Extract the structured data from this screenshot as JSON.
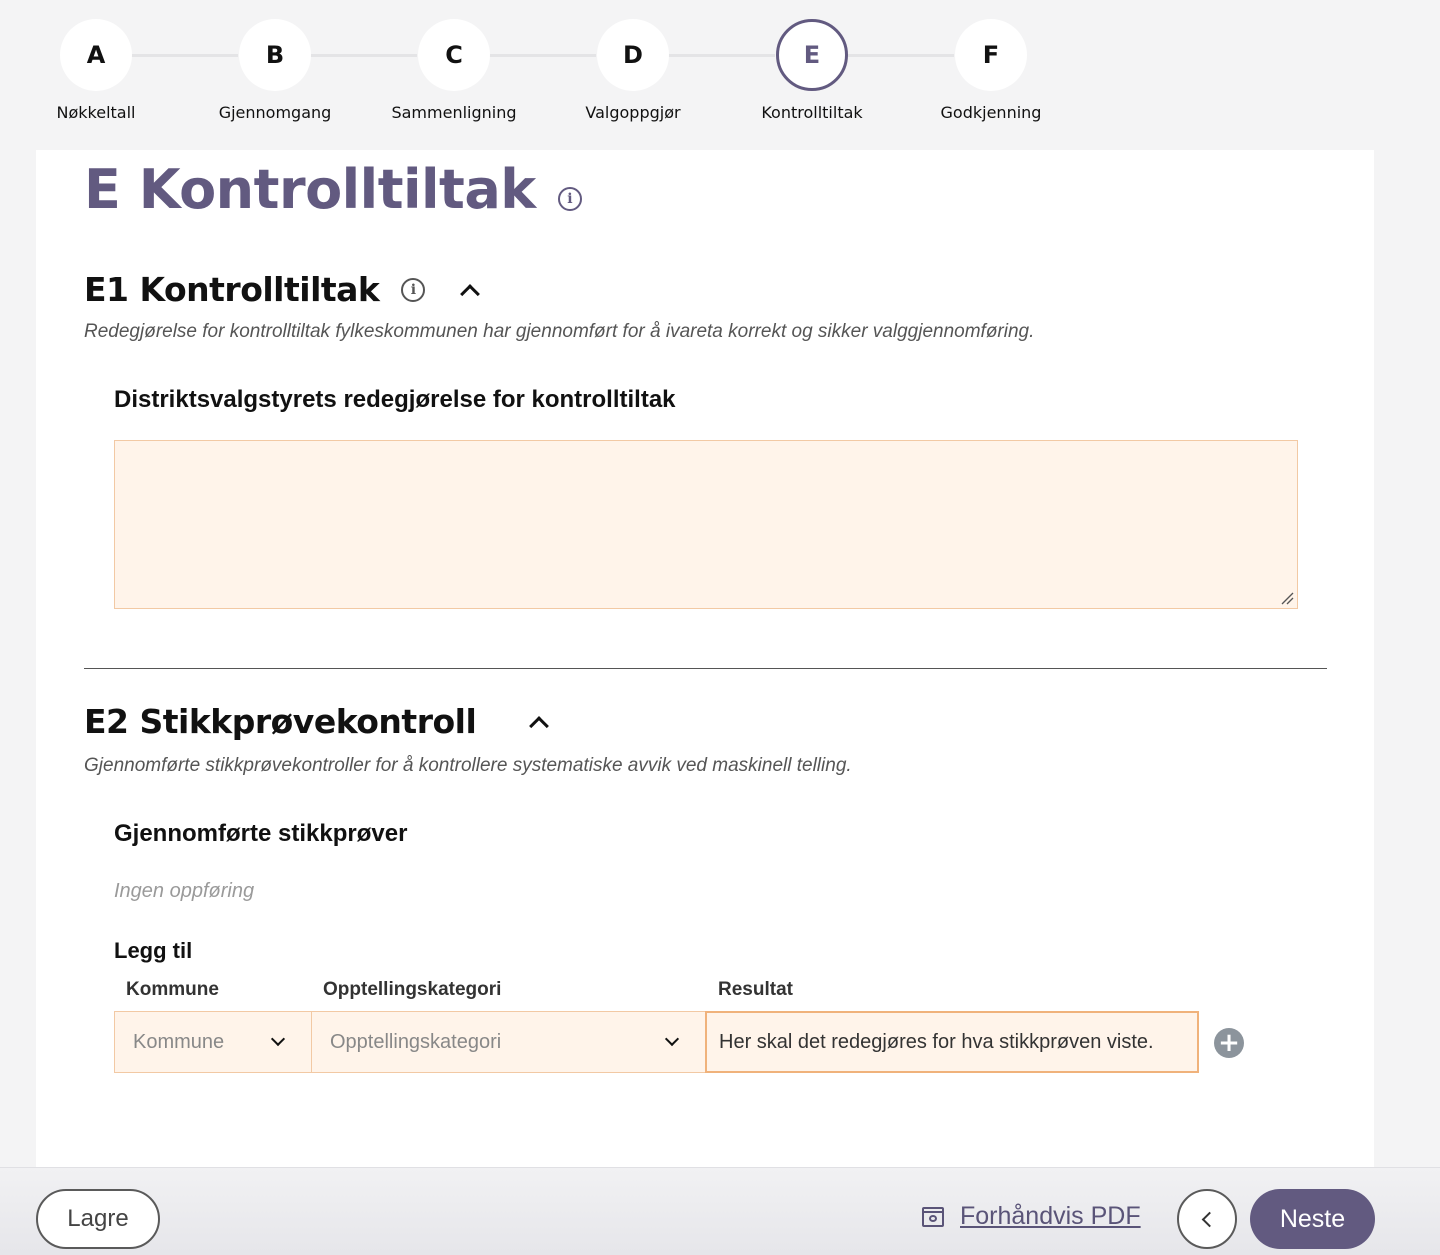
{
  "stepper": {
    "steps": [
      {
        "letter": "A",
        "label": "Nøkkeltall",
        "active": false
      },
      {
        "letter": "B",
        "label": "Gjennomgang",
        "active": false
      },
      {
        "letter": "C",
        "label": "Sammenligning",
        "active": false
      },
      {
        "letter": "D",
        "label": "Valgoppgjør",
        "active": false
      },
      {
        "letter": "E",
        "label": "Kontrolltiltak",
        "active": true
      },
      {
        "letter": "F",
        "label": "Godkjenning",
        "active": false
      }
    ]
  },
  "page": {
    "title": "E Kontrolltiltak"
  },
  "e1": {
    "title": "E1 Kontrolltiltak",
    "description": "Redegjørelse for kontrolltiltak fylkeskommunen har gjennomført for å ivareta korrekt og sikker valggjennomføring.",
    "field_label": "Distriktsvalgstyrets redegjørelse for kontrolltiltak",
    "field_value": ""
  },
  "e2": {
    "title": "E2 Stikkprøvekontroll",
    "description": "Gjennomførte stikkprøvekontroller for å kontrollere systematiske avvik ved maskinell telling.",
    "list_label": "Gjennomførte stikkprøver",
    "empty_text": "Ingen oppføring",
    "add_label": "Legg til",
    "columns": {
      "kommune": "Kommune",
      "kategori": "Opptellingskategori",
      "resultat": "Resultat"
    },
    "inputs": {
      "kommune_placeholder": "Kommune",
      "kategori_placeholder": "Opptellingskategori",
      "resultat_value": "Her skal det redegjøres for hva stikkprøven viste."
    }
  },
  "footer": {
    "save_label": "Lagre",
    "preview_label": "Forhåndvis PDF",
    "next_label": "Neste"
  },
  "colors": {
    "accent": "#625a80",
    "input_bg": "#fff4ea",
    "input_border": "#f2c9a4"
  }
}
